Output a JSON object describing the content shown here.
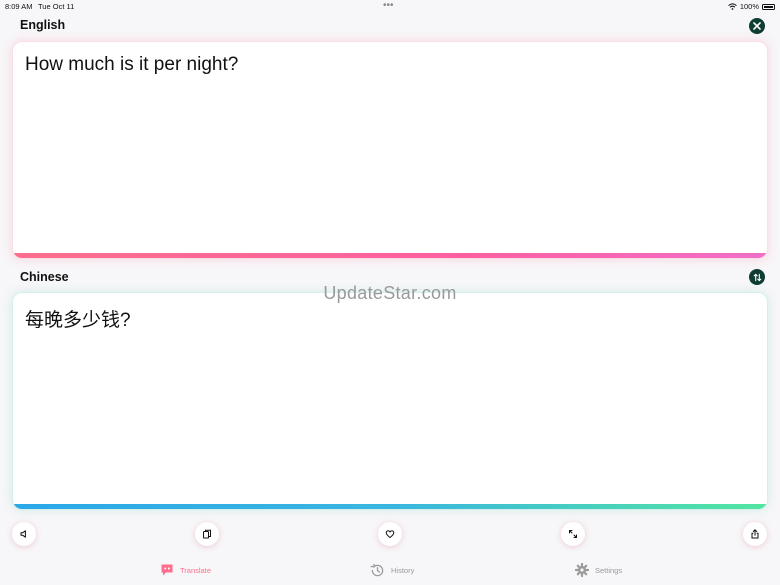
{
  "status_bar": {
    "time": "8:09 AM",
    "date": "Tue Oct 11",
    "battery": "100%"
  },
  "source": {
    "language": "English",
    "text": "How much is it per night?"
  },
  "target": {
    "language": "Chinese",
    "text": "每晚多少钱?"
  },
  "watermark": "UpdateStar.com",
  "actions": {
    "speak_icon": "speaker-icon",
    "copy_icon": "copy-icon",
    "favorite_icon": "heart-icon",
    "expand_icon": "expand-icon",
    "share_icon": "share-icon"
  },
  "tabs": [
    {
      "label": "Translate",
      "icon": "translate-icon",
      "active": true
    },
    {
      "label": "History",
      "icon": "history-icon",
      "active": false
    },
    {
      "label": "Settings",
      "icon": "gear-icon",
      "active": false
    }
  ],
  "colors": {
    "accent": "#ff6f8d",
    "dark_button": "#0f3d33",
    "inactive": "#9a9a9a"
  }
}
